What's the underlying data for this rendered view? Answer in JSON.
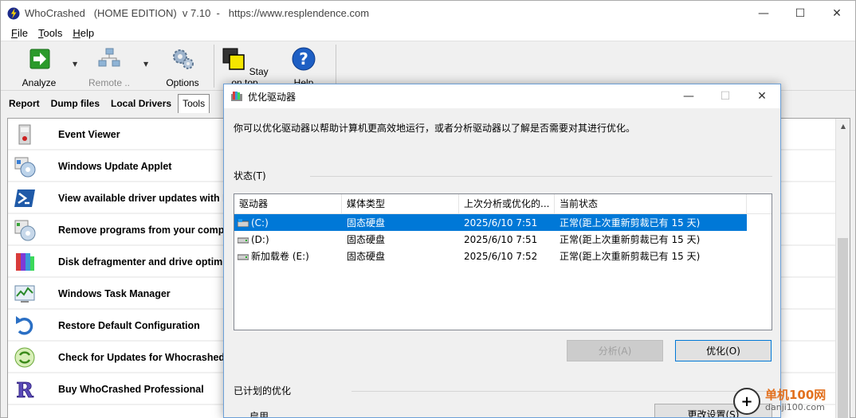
{
  "main_window": {
    "title": "WhoCrashed   (HOME EDITION)  v 7.10  -   https://www.resplendence.com",
    "controls": {
      "minimize": "—",
      "maximize": "☐",
      "close": "✕"
    }
  },
  "menu": [
    {
      "key": "F",
      "rest": "ile"
    },
    {
      "key": "T",
      "rest": "ools"
    },
    {
      "key": "H",
      "rest": "elp"
    }
  ],
  "toolbar": {
    "analyze": "Analyze",
    "remote": "Remote ..",
    "options": "Options",
    "stay_on_top": "Stay on top",
    "help": "Help",
    "dropdown": "▼"
  },
  "tabs": [
    "Report",
    "Dump files",
    "Local Drivers",
    "Tools"
  ],
  "tools_list": [
    {
      "label": "Event Viewer",
      "icon": "event-viewer-icon"
    },
    {
      "label": "Windows Update Applet",
      "icon": "windows-update-icon"
    },
    {
      "label": "View available driver updates with Po",
      "icon": "powershell-icon"
    },
    {
      "label": "Remove programs from your comput",
      "icon": "programs-icon"
    },
    {
      "label": "Disk defragmenter and drive optimiz",
      "icon": "defrag-icon"
    },
    {
      "label": "Windows Task Manager",
      "icon": "task-manager-icon"
    },
    {
      "label": "Restore Default Configuration",
      "icon": "restore-icon"
    },
    {
      "label": "Check for Updates for Whocrashed",
      "icon": "update-check-icon"
    },
    {
      "label": "Buy WhoCrashed Professional",
      "icon": "buy-icon"
    }
  ],
  "dialog": {
    "title": "优化驱动器",
    "description": "你可以优化驱动器以帮助计算机更高效地运行，或者分析驱动器以了解是否需要对其进行优化。",
    "status_label": "状态(T)",
    "columns": [
      "驱动器",
      "媒体类型",
      "上次分析或优化的...",
      "当前状态"
    ],
    "drives": [
      {
        "name": "(C:)",
        "media": "固态硬盘",
        "last": "2025/6/10 7:51",
        "status": "正常(距上次重新剪裁已有 15 天)",
        "selected": true
      },
      {
        "name": "(D:)",
        "media": "固态硬盘",
        "last": "2025/6/10 7:51",
        "status": "正常(距上次重新剪裁已有 15 天)",
        "selected": false
      },
      {
        "name": "新加载卷 (E:)",
        "media": "固态硬盘",
        "last": "2025/6/10 7:52",
        "status": "正常(距上次重新剪裁已有 15 天)",
        "selected": false
      }
    ],
    "analyze_button": "分析(A)",
    "optimize_button": "优化(O)",
    "scheduled_label": "已计划的优化",
    "enabled_label": "启用",
    "change_settings_button": "更改设置(S)"
  },
  "watermark": {
    "cn": "单机100网",
    "url": "danji100.com"
  }
}
